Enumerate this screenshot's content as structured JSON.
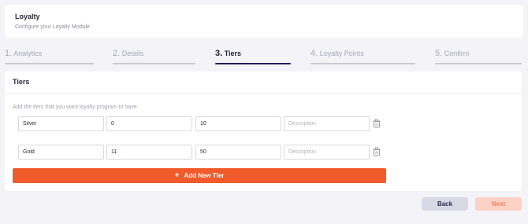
{
  "header": {
    "title": "Loyalty",
    "subtitle": "Configure your Loyalty Module"
  },
  "steps": [
    {
      "num": "1.",
      "label": "Analytics",
      "active": false
    },
    {
      "num": "2.",
      "label": "Details",
      "active": false
    },
    {
      "num": "3.",
      "label": "Tiers",
      "active": true
    },
    {
      "num": "4.",
      "label": "Loyalty Points",
      "active": false
    },
    {
      "num": "5.",
      "label": "Confirm",
      "active": false
    }
  ],
  "card": {
    "title": "Tiers",
    "hint": "Add the tiers that you want loyalty program to have",
    "rows": [
      {
        "name": "Silver",
        "min": "0",
        "max": "10",
        "description_placeholder": "Description"
      },
      {
        "name": "Gold",
        "min": "11",
        "max": "50",
        "description_placeholder": "Description"
      }
    ],
    "add_label": "Add New Tier"
  },
  "footer": {
    "back_label": "Back",
    "next_label": "Next"
  },
  "colors": {
    "accent": "#f15a2b",
    "active_step": "#1f2152",
    "next_disabled_bg": "#fcd2c4"
  },
  "icons": {
    "delete": "trash-icon",
    "add": "plus-icon"
  }
}
